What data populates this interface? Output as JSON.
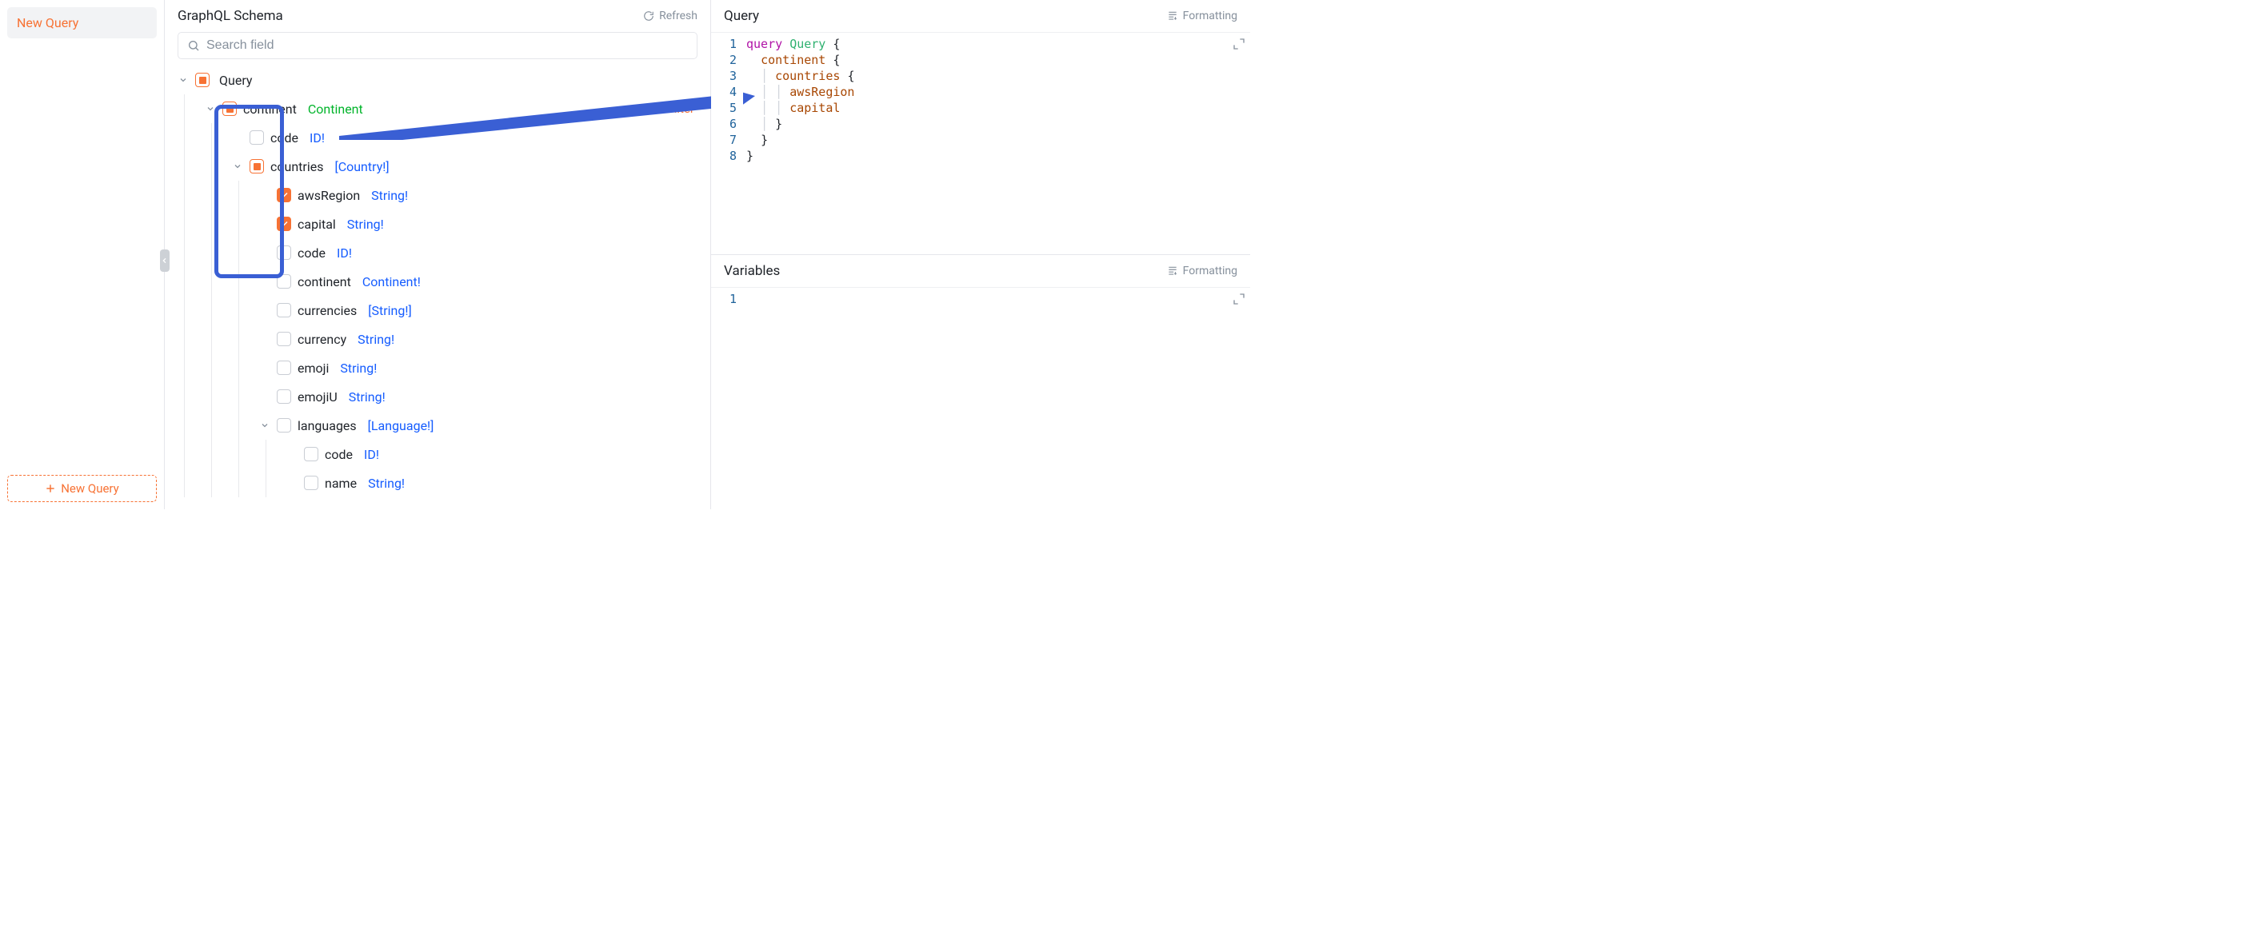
{
  "sidebar": {
    "active_tab": "New Query",
    "add_button": "New Query"
  },
  "schema": {
    "title": "GraphQL Schema",
    "refresh": "Refresh",
    "search_placeholder": "Search field",
    "root": {
      "name": "Query"
    },
    "continent": {
      "name": "continent",
      "type": "Continent",
      "filter": "Filter"
    },
    "continent_code": {
      "name": "code",
      "type": "ID!"
    },
    "countries": {
      "name": "countries",
      "type": "[Country!]"
    },
    "awsRegion": {
      "name": "awsRegion",
      "type": "String!"
    },
    "capital": {
      "name": "capital",
      "type": "String!"
    },
    "c_code": {
      "name": "code",
      "type": "ID!"
    },
    "c_continent": {
      "name": "continent",
      "type": "Continent!"
    },
    "currencies": {
      "name": "currencies",
      "type": "[String!]"
    },
    "currency": {
      "name": "currency",
      "type": "String!"
    },
    "emoji": {
      "name": "emoji",
      "type": "String!"
    },
    "emojiU": {
      "name": "emojiU",
      "type": "String!"
    },
    "languages": {
      "name": "languages",
      "type": "[Language!]"
    },
    "l_code": {
      "name": "code",
      "type": "ID!"
    },
    "l_name": {
      "name": "name",
      "type": "String!"
    }
  },
  "query": {
    "title": "Query",
    "formatting": "Formatting",
    "lines": [
      "1",
      "2",
      "3",
      "4",
      "5",
      "6",
      "7",
      "8"
    ],
    "code": {
      "kw_query": "query",
      "op_name": "Query",
      "continent": "continent",
      "countries": "countries",
      "awsRegion": "awsRegion",
      "capital": "capital"
    }
  },
  "variables": {
    "title": "Variables",
    "formatting": "Formatting",
    "lines": [
      "1"
    ]
  }
}
